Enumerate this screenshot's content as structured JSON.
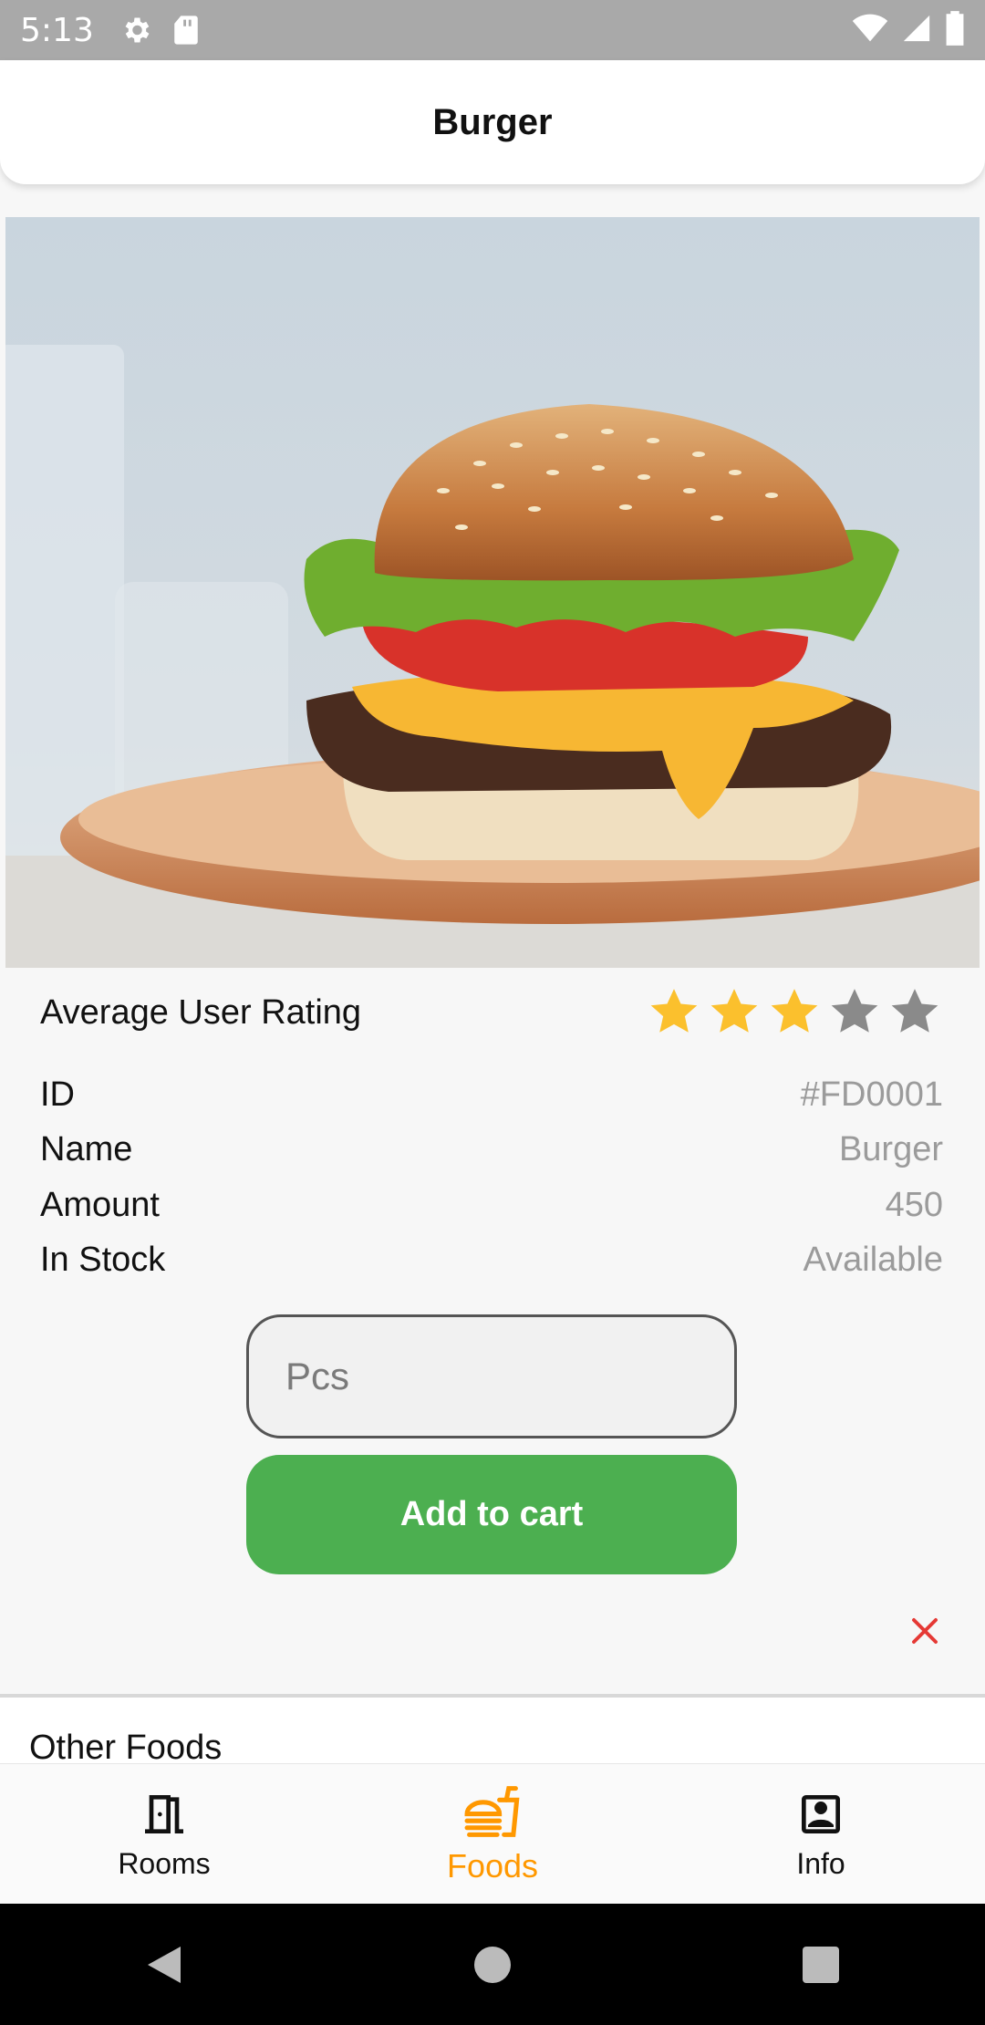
{
  "status_bar": {
    "time": "5:13"
  },
  "app_bar": {
    "title": "Burger"
  },
  "details": {
    "rating_label": "Average User Rating",
    "rating_value": 3,
    "rating_max": 5,
    "id_label": "ID",
    "id_value": "#FD0001",
    "name_label": "Name",
    "name_value": "Burger",
    "amount_label": "Amount",
    "amount_value": "450",
    "stock_label": "In Stock",
    "stock_value": "Available"
  },
  "quantity_input": {
    "placeholder": "Pcs",
    "value": ""
  },
  "add_to_cart": {
    "label": "Add to cart"
  },
  "other_foods": {
    "title": "Other Foods"
  },
  "bottom_nav": {
    "items": [
      {
        "label": "Rooms",
        "icon": "door-icon"
      },
      {
        "label": "Foods",
        "icon": "fastfood-icon",
        "active": true
      },
      {
        "label": "Info",
        "icon": "contact-card-icon"
      }
    ]
  },
  "colors": {
    "accent": "#ff9800",
    "button": "#4caf50",
    "star_filled": "#fbc02d",
    "star_empty": "#8a8a8a",
    "close": "#e53935"
  }
}
